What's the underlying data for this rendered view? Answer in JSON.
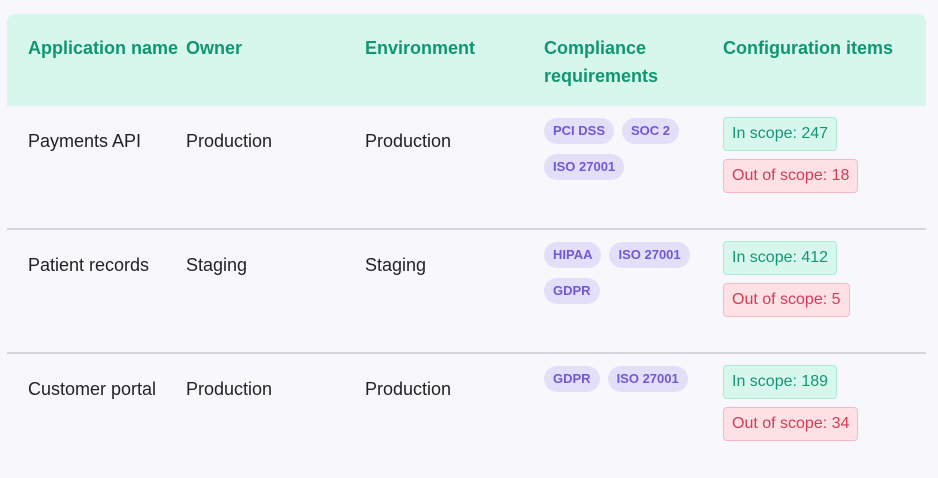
{
  "header": {
    "application_name": "Application name",
    "owner": "Owner",
    "environment": "Environment",
    "compliance": "Compliance requirements",
    "configuration": "Configuration items"
  },
  "rows": [
    {
      "application": "Payments API",
      "owner": "Production",
      "environment": "Production",
      "compliance": [
        "PCI DSS",
        "SOC 2",
        "ISO 27001"
      ],
      "in_scope": "In scope: 247",
      "out_scope": "Out of scope: 18"
    },
    {
      "application": "Patient records",
      "owner": "Staging",
      "environment": "Staging",
      "compliance": [
        "HIPAA",
        "ISO 27001",
        "GDPR"
      ],
      "in_scope": "In scope: 412",
      "out_scope": "Out of scope: 5"
    },
    {
      "application": "Customer portal",
      "owner": "Production",
      "environment": "Production",
      "compliance": [
        "GDPR",
        "ISO 27001"
      ],
      "in_scope": "In scope: 189",
      "out_scope": "Out of scope: 34"
    }
  ],
  "colors": {
    "header_bg": "#d8f7ec",
    "header_text": "#119672",
    "badge_bg": "#e4dff8",
    "badge_text": "#7257d6",
    "in_scope_bg": "#d8f7ec",
    "out_scope_bg": "#fde1e5"
  }
}
